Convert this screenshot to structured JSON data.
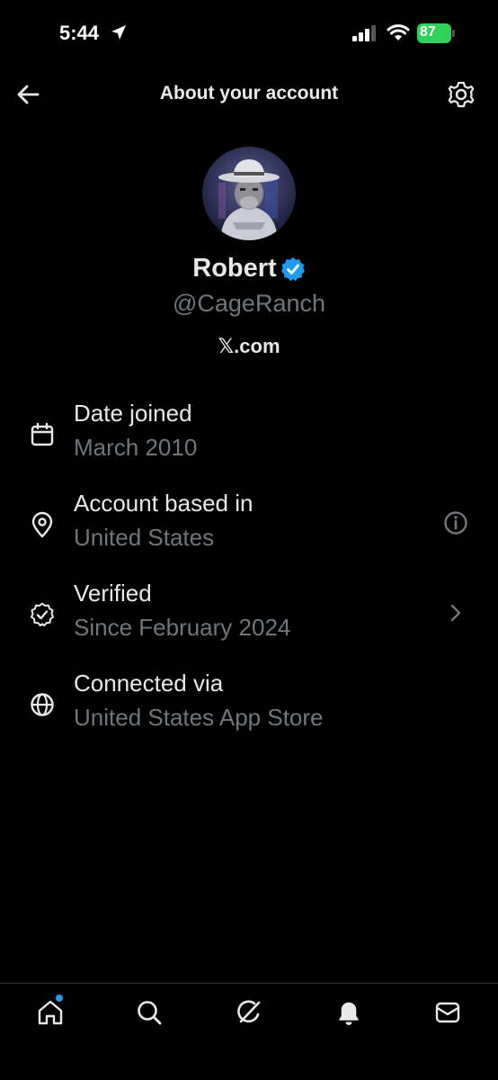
{
  "status_bar": {
    "time": "5:44",
    "battery": "87",
    "battery_color": "#30d158"
  },
  "header": {
    "title": "About your account",
    "back_icon": "arrow-left-icon",
    "settings_icon": "gear-icon"
  },
  "profile": {
    "display_name": "Robert",
    "handle": "@CageRanch",
    "website": "𝕏.com",
    "verified_color": "#1d9bf0"
  },
  "info_rows": [
    {
      "icon": "calendar-icon",
      "label": "Date joined",
      "value": "March 2010"
    },
    {
      "icon": "location-pin-icon",
      "label": "Account based in",
      "value": "United States",
      "action_icon": "info-icon"
    },
    {
      "icon": "verified-check-icon",
      "label": "Verified",
      "value": "Since February 2024",
      "action_icon": "chevron-right-icon"
    },
    {
      "icon": "globe-icon",
      "label": "Connected via",
      "value": "United States App Store"
    }
  ],
  "bottom_nav": {
    "items": [
      "home-icon",
      "search-icon",
      "grok-icon",
      "notifications-bell-icon",
      "messages-envelope-icon"
    ],
    "accent": "#1d9bf0"
  }
}
